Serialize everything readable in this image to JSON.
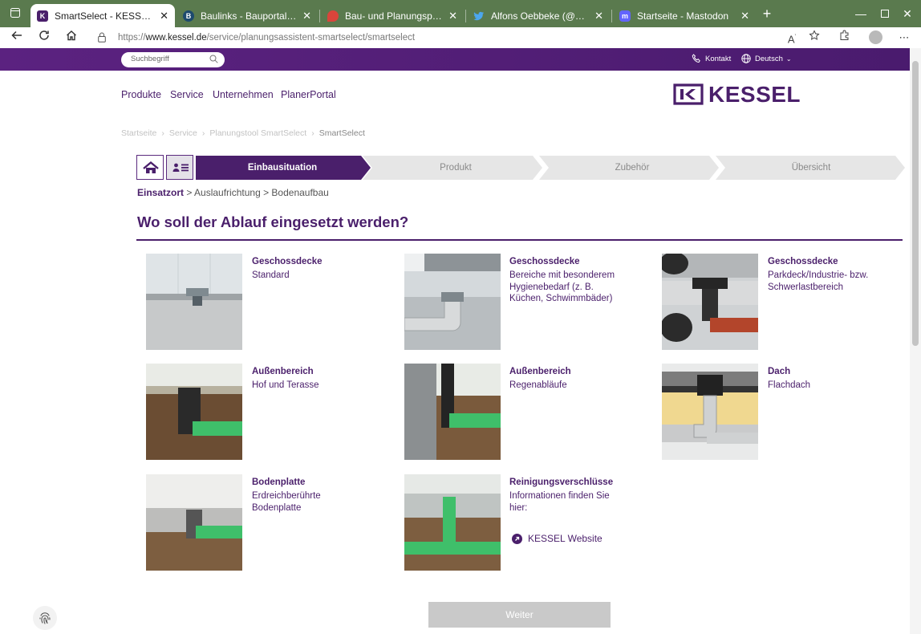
{
  "browser": {
    "tabs": [
      {
        "title": "SmartSelect - KESSEL - Führend i",
        "active": true,
        "favicon": "kessel-favicon"
      },
      {
        "title": "Baulinks - Bauportal / Baumagaz",
        "active": false,
        "favicon": "baulinks-favicon"
      },
      {
        "title": "Bau- und Planungsprojekte auf B",
        "active": false,
        "favicon": "map-pin-favicon"
      },
      {
        "title": "Alfons Oebbeke (@oebbeke) / Tw",
        "active": false,
        "favicon": "twitter-favicon"
      },
      {
        "title": "Startseite - Mastodon",
        "active": false,
        "favicon": "mastodon-favicon"
      }
    ],
    "url_prefix": "https://",
    "url_host": "www.kessel.de",
    "url_path": "/service/planungsassistent-smartselect/smartselect"
  },
  "header": {
    "search_placeholder": "Suchbegriff",
    "contact": "Kontakt",
    "language": "Deutsch"
  },
  "nav": [
    "Produkte",
    "Service",
    "Unternehmen",
    "PlanerPortal"
  ],
  "logo": "KESSEL",
  "breadcrumb": [
    "Startseite",
    "Service",
    "Planungstool SmartSelect",
    "SmartSelect"
  ],
  "steps": [
    "Einbausituation",
    "Produkt",
    "Zubehör",
    "Übersicht"
  ],
  "subcrumbs": {
    "first": "Einsatzort",
    "rest": " > Auslaufrichtung > Bodenaufbau"
  },
  "heading": "Wo soll der Ablauf eingesetzt werden?",
  "tiles": [
    {
      "title": "Geschossdecke",
      "lines": [
        "Standard"
      ]
    },
    {
      "title": "Geschossdecke",
      "lines": [
        "Bereiche mit besonderem",
        "Hygienebedarf (z. B.",
        "Küchen, Schwimmbäder)"
      ]
    },
    {
      "title": "Geschossdecke",
      "lines": [
        "Parkdeck/Industrie- bzw.",
        "Schwerlastbereich"
      ]
    },
    {
      "title": "Außenbereich",
      "lines": [
        "Hof und Terasse"
      ]
    },
    {
      "title": "Außenbereich",
      "lines": [
        "Regenabläufe"
      ]
    },
    {
      "title": "Dach",
      "lines": [
        "Flachdach"
      ]
    },
    {
      "title": "Bodenplatte",
      "lines": [
        "Erdreichberührte",
        "Bodenplatte"
      ]
    },
    {
      "title": "Reinigungsverschlüsse",
      "lines": [
        "Informationen finden Sie",
        "hier:"
      ]
    }
  ],
  "external_link": "KESSEL Website",
  "next_button": "Weiter",
  "colors": {
    "brand": "#4a1f6b",
    "step_inactive": "#e6e6e6",
    "tab_bar": "#5a7a4e",
    "pipe_green": "#3fbf6a"
  }
}
